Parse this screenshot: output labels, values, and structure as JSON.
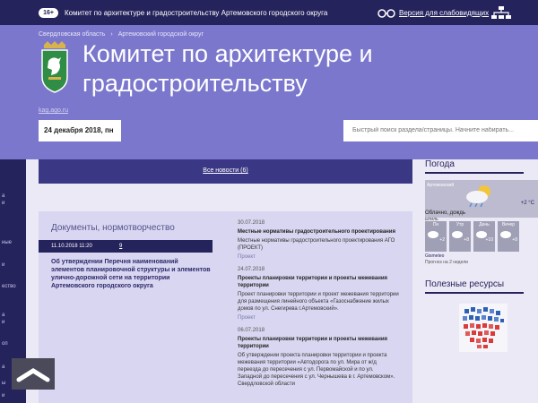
{
  "topbar": {
    "age": "16+",
    "title": "Комитет по архитектуре и градостроительству Артемовского городского округа",
    "a11y_link": "Версия для слабовидящих"
  },
  "header": {
    "breadcrumbs": [
      "Свердловская область",
      "Артемовский городской округ"
    ],
    "title": "Комитет по архитектуре и градостроительству",
    "small_link": "kag.ago.ru",
    "date": "24 декабря 2018, пн",
    "search_placeholder": "Быстрый поиск раздела/страницы. Начните набирать..."
  },
  "left_rail": {
    "labels": [
      "а",
      "и",
      "ные",
      "и",
      "ество",
      "а",
      "и",
      "оп",
      "а",
      "ы",
      "и"
    ]
  },
  "news_bar": {
    "all_news": "Все новости (6)"
  },
  "documents": {
    "title": "Документы, нормотворчество",
    "featured": {
      "date": "11.10.2018 11:20",
      "number": "9",
      "text": "Об утверждении Перечня наименований элементов планировочной структуры и элементов улично-дорожной сети на территории Артемовского городского округа"
    }
  },
  "news": [
    {
      "date": "30.07.2018",
      "title": "Местные нормативы градостроительного проектирования",
      "text": "Местные нормативы градостроительного проектирования АГО (ПРОЕКТ)",
      "tag": "Проект"
    },
    {
      "date": "24.07.2018",
      "title": "Проекты планировки территории и проекты межевания территории",
      "text": "Проект планировки территории и проект межевания территории для размещения линейного объекта «Газоснабжение жилых домов по ул. Снегирева г.Артемовский».",
      "tag": "Проект"
    },
    {
      "date": "06.07.2018",
      "title": "Проекты планировки территории и проекты межевания территории",
      "text": "Об утверждении проекта планировки территории и проекта межевания территории «Автодорога по ул. Мира от ж/д переезда до пересечения с ул. Первомайской и по ул. Западной до пересечения с ул. Чернышева в г. Артемовском». Свердловской области"
    }
  ],
  "weather": {
    "heading": "Погода",
    "city": "Артемовский",
    "temp": "+2 °C",
    "description": "Облачно, дождь",
    "wind": "штиль",
    "days": [
      {
        "name": "Пн",
        "temp": "+2"
      },
      {
        "name": "Утр",
        "temp": "+8"
      },
      {
        "name": "День",
        "temp": "+10"
      },
      {
        "name": "Вечер",
        "temp": "+8"
      }
    ],
    "source": "Gismeteo",
    "forecast_note": "Прогноз на 2 недели"
  },
  "resources": {
    "heading": "Полезные ресурсы"
  },
  "colors": {
    "header_bg": "#7b77cc",
    "dark_navy": "#25235b",
    "panel": "#d8d6f0",
    "page_bg": "#ece9f6"
  }
}
